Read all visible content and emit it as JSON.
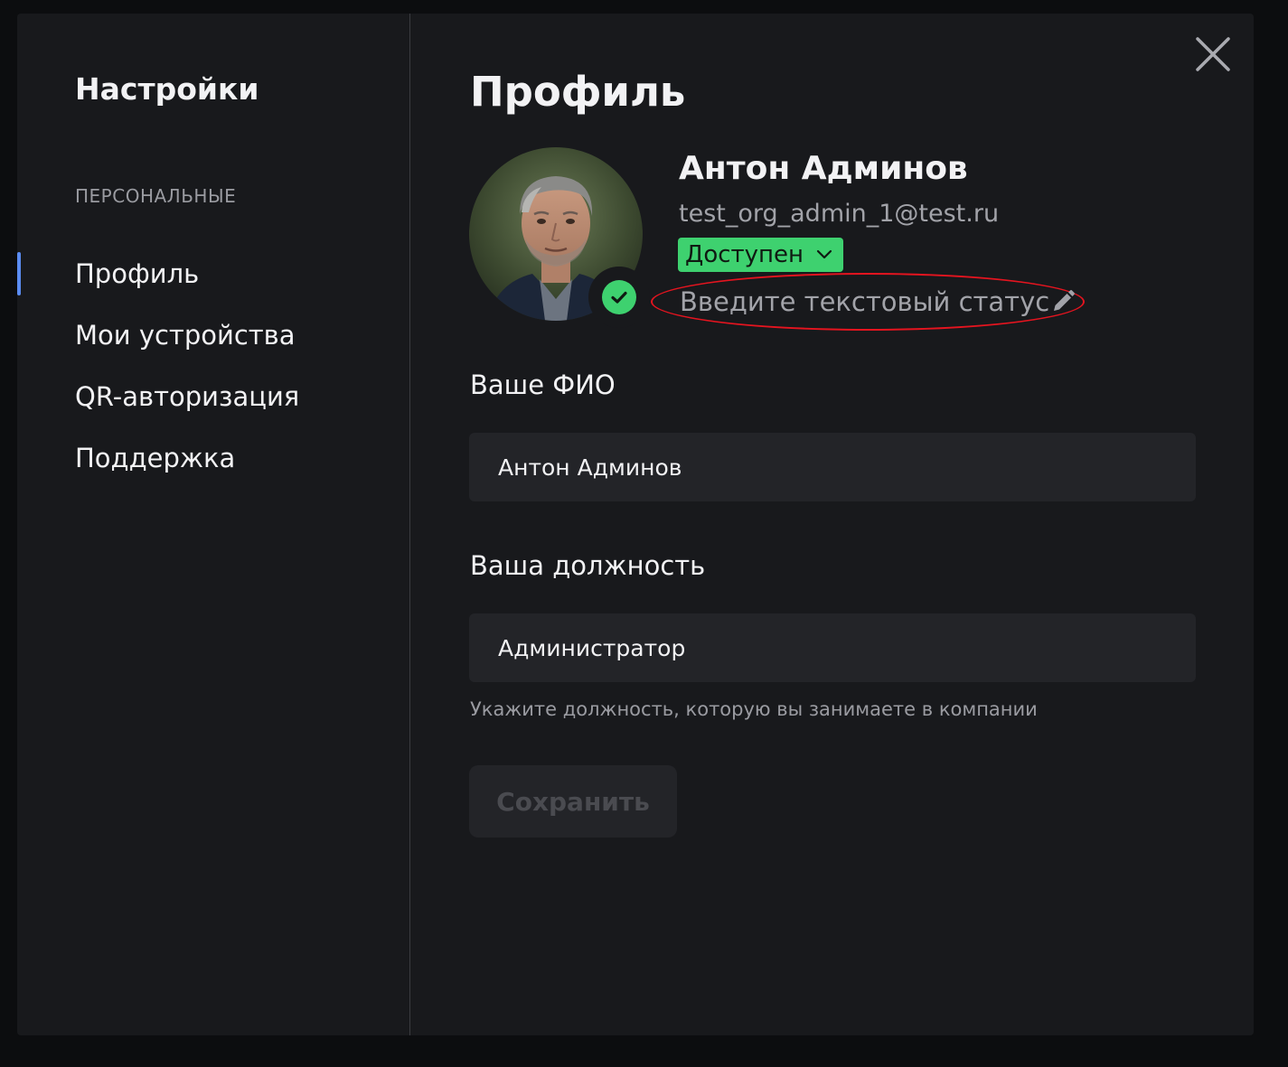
{
  "sidebar": {
    "title": "Настройки",
    "section_label": "ПЕРСОНАЛЬНЫЕ",
    "items": [
      {
        "label": "Профиль",
        "active": true
      },
      {
        "label": "Мои устройства",
        "active": false
      },
      {
        "label": "QR-авторизация",
        "active": false
      },
      {
        "label": "Поддержка",
        "active": false
      }
    ]
  },
  "profile": {
    "page_title": "Профиль",
    "name": "Антон Админов",
    "email": "test_org_admin_1@test.ru",
    "presence_status": "Доступен",
    "text_status_placeholder": "Введите текстовый статус"
  },
  "form": {
    "fio_label": "Ваше ФИО",
    "fio_value": "Антон Админов",
    "position_label": "Ваша должность",
    "position_value": "Администратор",
    "position_hint": "Укажите должность, которую вы занимаете в компании",
    "save_label": "Сохранить"
  },
  "colors": {
    "accent": "#5b8cf2",
    "status_green": "#3ed16f",
    "highlight_red": "#e5141f"
  },
  "icons": {
    "close": "close-icon",
    "check": "check-icon",
    "chevron": "chevron-down-icon",
    "pencil": "pencil-icon"
  }
}
